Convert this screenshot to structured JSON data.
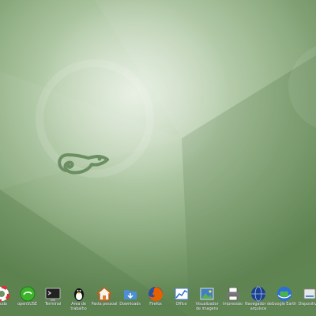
{
  "desktop": {
    "launchers": [
      {
        "label": "Ajuda",
        "icon": "help-lifebuoy-icon"
      },
      {
        "label": "openSUSE",
        "icon": "opensuse-green-icon"
      },
      {
        "label": "Terminal",
        "icon": "terminal-icon"
      },
      {
        "label": "Área de trabalho",
        "icon": "tux-penguin-icon"
      },
      {
        "label": "Pasta pessoal",
        "icon": "home-folder-icon"
      },
      {
        "label": "Downloads",
        "icon": "downloads-folder-icon"
      },
      {
        "label": "Firefox",
        "icon": "firefox-icon"
      },
      {
        "label": "Office",
        "icon": "office-chart-icon"
      },
      {
        "label": "Visualizador de imagens",
        "icon": "image-viewer-icon"
      },
      {
        "label": "Impressão",
        "icon": "printer-icon"
      },
      {
        "label": "Navegador de arquivos",
        "icon": "network-globe-icon"
      },
      {
        "label": "Google Earth",
        "icon": "google-earth-icon"
      },
      {
        "label": "Dispositivos",
        "icon": "drive-icon"
      }
    ]
  }
}
